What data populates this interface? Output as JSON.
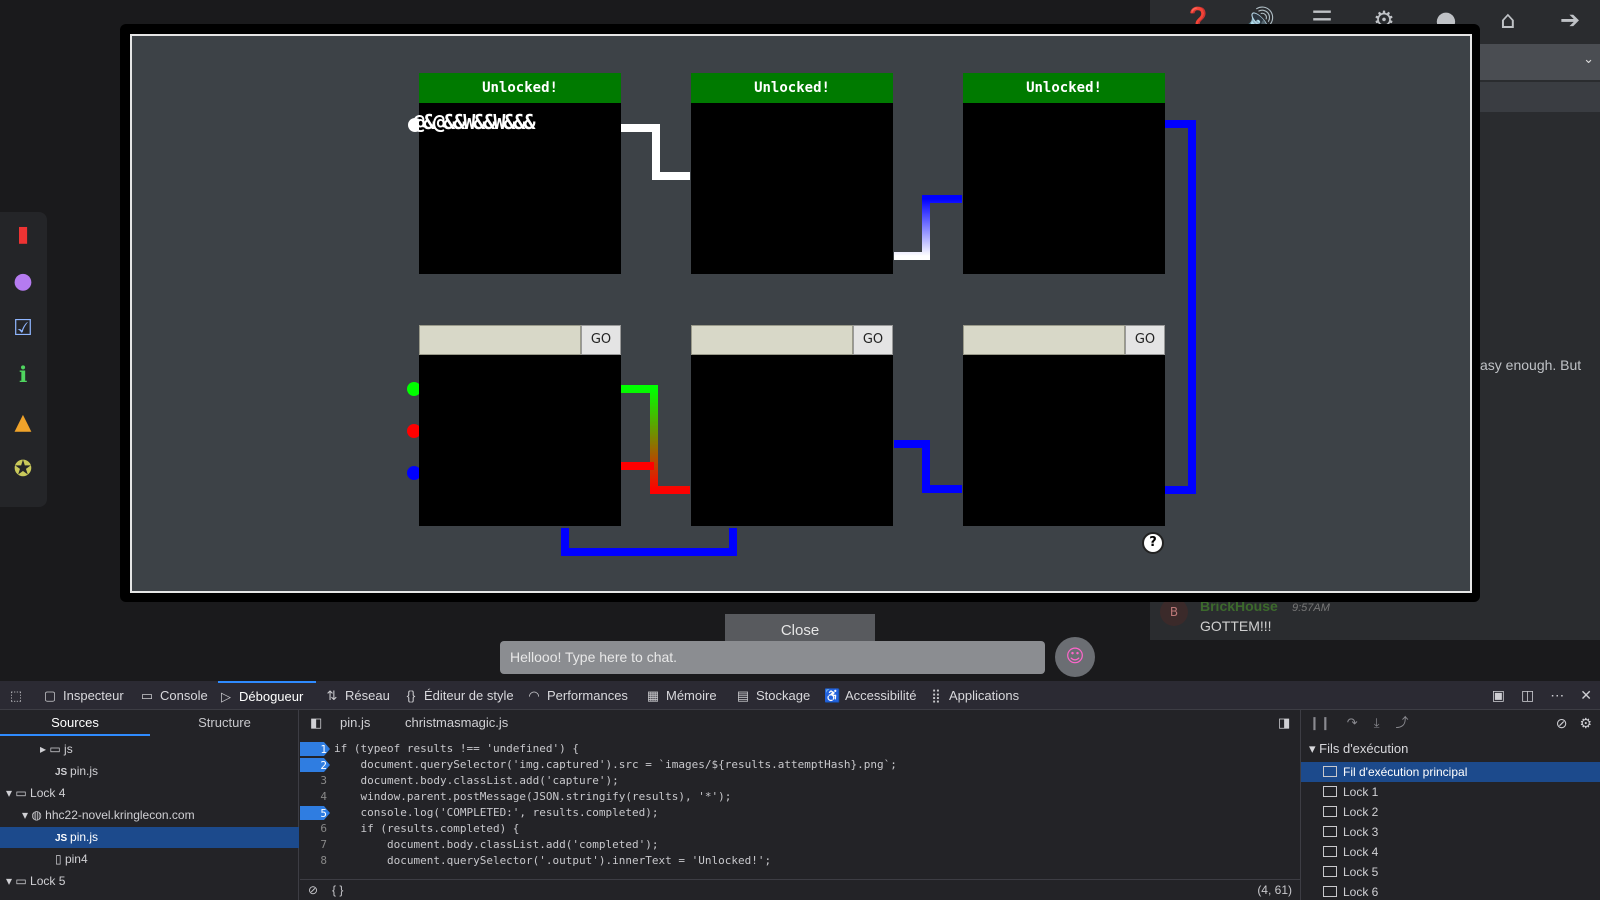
{
  "right_toolbar": {
    "icons": [
      "help-icon",
      "volume-icon",
      "list-icon",
      "settings-icon",
      "account-icon",
      "home-icon",
      "exit-icon"
    ]
  },
  "chat": {
    "snippet": "asy enough. But",
    "message": {
      "user": "BrickHouse",
      "time": "9:57AM",
      "text": "GOTTEM!!!",
      "avatar_letter": "B"
    },
    "input_placeholder": "Hellooo! Type here to chat."
  },
  "left_dock": {
    "icons": [
      "book-icon",
      "map-pin-icon",
      "checklist-icon",
      "info-icon",
      "hat-icon",
      "badge-icon"
    ]
  },
  "modal": {
    "locks_unlocked": [
      "Unlocked!",
      "Unlocked!",
      "Unlocked!"
    ],
    "go_label": "GO",
    "captured_text": "@&@&&W&&W&&&",
    "help_label": "?",
    "close_label": "Close"
  },
  "devtools": {
    "tabs": [
      "Inspecteur",
      "Console",
      "Débogueur",
      "Réseau",
      "Éditeur de style",
      "Performances",
      "Mémoire",
      "Stockage",
      "Accessibilité",
      "Applications"
    ],
    "active_tab": "Débogueur",
    "sources": {
      "tabs": [
        "Sources",
        "Structure"
      ],
      "tree": [
        {
          "label": "js",
          "type": "folder"
        },
        {
          "label": "pin.js",
          "type": "file"
        },
        {
          "label": "Lock 4",
          "type": "frame"
        },
        {
          "label": "hhc22-novel.kringlecon.com",
          "type": "domain"
        },
        {
          "label": "pin.js",
          "type": "file",
          "selected": true
        },
        {
          "label": "pin4",
          "type": "doc"
        },
        {
          "label": "Lock 5",
          "type": "frame"
        }
      ]
    },
    "editor": {
      "tabs": [
        "pin.js",
        "christmasmagic.js"
      ],
      "lines": [
        {
          "n": "1",
          "code": "if (typeof results !== 'undefined') {",
          "bp": true
        },
        {
          "n": "2",
          "code": "    document.querySelector('img.captured').src = `images/${results.attemptHash}.png`;",
          "bp": true
        },
        {
          "n": "3",
          "code": "    document.body.classList.add('capture');",
          "bp": false
        },
        {
          "n": "4",
          "code": "    window.parent.postMessage(JSON.stringify(results), '*');",
          "bp": false
        },
        {
          "n": "5",
          "code": "    console.log('COMPLETED:', results.completed);",
          "bp": true
        },
        {
          "n": "6",
          "code": "    if (results.completed) {",
          "bp": false
        },
        {
          "n": "7",
          "code": "        document.body.classList.add('completed');",
          "bp": false
        },
        {
          "n": "8",
          "code": "        document.querySelector('.output').innerText = 'Unlocked!';",
          "bp": false
        }
      ],
      "footer_braces": "{ }",
      "cursor_pos": "(4, 61)"
    },
    "threads": {
      "title": "Fils d'exécution",
      "items": [
        "Fil d'exécution principal",
        "Lock 1",
        "Lock 2",
        "Lock 3",
        "Lock 4",
        "Lock 5",
        "Lock 6"
      ]
    }
  }
}
